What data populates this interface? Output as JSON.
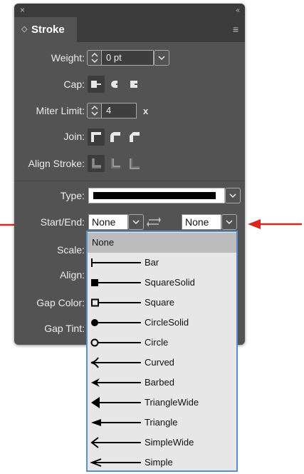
{
  "panel": {
    "close_glyph": "×",
    "collapse_glyph": "‹‹",
    "tab_icon": "◇",
    "tab_label": "Stroke",
    "menu_glyph": "≡"
  },
  "labels": {
    "weight": "Weight:",
    "cap": "Cap:",
    "miter_limit": "Miter Limit:",
    "join": "Join:",
    "align_stroke": "Align Stroke:",
    "type": "Type:",
    "start_end": "Start/End:",
    "scale": "Scale:",
    "align": "Align:",
    "gap_color": "Gap Color:",
    "gap_tint": "Gap Tint:"
  },
  "weight": {
    "value": "0 pt"
  },
  "miter_limit": {
    "value": "4",
    "suffix": "x"
  },
  "start": {
    "value": "None"
  },
  "end": {
    "value": "None"
  },
  "dropdown_items": [
    {
      "label": "None",
      "icon": "none",
      "selected": true
    },
    {
      "label": "Bar",
      "icon": "bar-end"
    },
    {
      "label": "SquareSolid",
      "icon": "square-solid-end"
    },
    {
      "label": "Square",
      "icon": "square-end"
    },
    {
      "label": "CircleSolid",
      "icon": "circle-solid-end"
    },
    {
      "label": "Circle",
      "icon": "circle-end"
    },
    {
      "label": "Curved",
      "icon": "curved-arrow-end"
    },
    {
      "label": "Barbed",
      "icon": "barbed-arrow-end"
    },
    {
      "label": "TriangleWide",
      "icon": "triangle-wide-arrow-end"
    },
    {
      "label": "Triangle",
      "icon": "triangle-arrow-end"
    },
    {
      "label": "SimpleWide",
      "icon": "simple-wide-arrow-end"
    },
    {
      "label": "Simple",
      "icon": "simple-arrow-end"
    }
  ],
  "colors": {
    "panel_bg": "#535353",
    "title_bg": "#3b3b3b",
    "dropdown_border": "#5a8ec9",
    "dropdown_bg": "#e7e7e7",
    "dropdown_highlight": "#bcbcbc",
    "indicator_arrow": "#d6281e"
  }
}
